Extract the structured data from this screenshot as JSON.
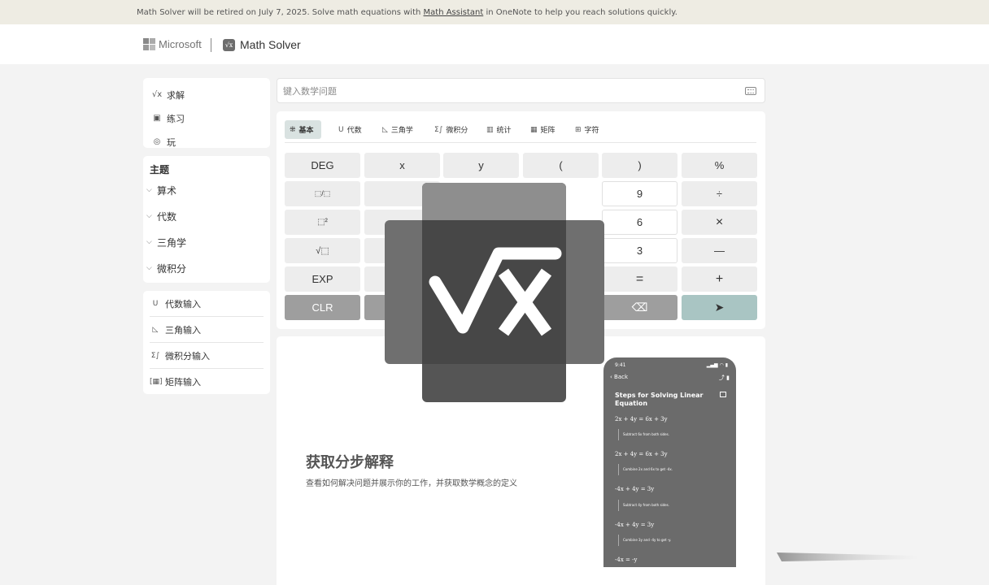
{
  "banner": {
    "text_before": "Math Solver will be retired on July 7, 2025. Solve math equations with ",
    "link": "Math Assistant",
    "text_after": " in OneNote to help you reach solutions quickly."
  },
  "header": {
    "brand": "Microsoft",
    "app_icon": "√x",
    "app_title": "Math Solver"
  },
  "nav": {
    "items": [
      {
        "icon": "√x",
        "label": "求解"
      },
      {
        "icon": "▣",
        "label": "练习"
      },
      {
        "icon": "◎",
        "label": "玩"
      }
    ]
  },
  "topics": {
    "title": "主题",
    "items": [
      {
        "label": "算术"
      },
      {
        "label": "代数"
      },
      {
        "label": "三角学"
      },
      {
        "label": "微积分"
      }
    ]
  },
  "inputs": {
    "items": [
      {
        "icon": "U",
        "label": "代数输入"
      },
      {
        "icon": "◺",
        "label": "三角输入"
      },
      {
        "icon": "Σ∫",
        "label": "微积分输入"
      },
      {
        "icon": "[▦]",
        "label": "矩阵输入"
      }
    ]
  },
  "search": {
    "placeholder": "键入数学问题"
  },
  "calculator": {
    "tabs": [
      {
        "icon": "⁜",
        "label": "基本"
      },
      {
        "icon": "U",
        "label": "代数"
      },
      {
        "icon": "◺",
        "label": "三角学"
      },
      {
        "icon": "Σ∫",
        "label": "微积分"
      },
      {
        "icon": "▥",
        "label": "统计"
      },
      {
        "icon": "▦",
        "label": "矩阵"
      },
      {
        "icon": "⊞",
        "label": "字符"
      }
    ],
    "keys": {
      "deg": "DEG",
      "x": "x",
      "y": "y",
      "lparen": "(",
      "rparen": ")",
      "percent": "%",
      "fraction": "⬚/⬚",
      "nine": "9",
      "divide": "÷",
      "power": "⬚²",
      "six": "6",
      "multiply": "×",
      "sqrt": "√⬚",
      "three": "3",
      "minus": "—",
      "exp": "EXP",
      "equals": "=",
      "plus": "+",
      "clr": "CLR",
      "backspace": "⌫",
      "send": "➤"
    }
  },
  "promo": {
    "title": "获取分步解释",
    "subtitle": "查看如何解决问题并展示你的工作，并获取数学概念的定义"
  },
  "phone": {
    "time": "9:41",
    "status_icons": "▂▄▆ ◠ ▮",
    "back": "‹  Back",
    "actions": "⤴  ▮",
    "steps_title": "Steps for Solving Linear Equation",
    "steps": [
      {
        "eq": "2x + 4y = 6x + 3y",
        "note": "Subtract 6x from both sides."
      },
      {
        "eq": "2x + 4y = 6x + 3y",
        "note": "Combine 2x and 6x to get -4x."
      },
      {
        "eq": "-4x + 4y = 3y",
        "note": "Subtract 4y from both sides."
      },
      {
        "eq": "-4x + 4y = 3y",
        "note": "Combine 3y and -4y to get -y."
      },
      {
        "eq": "-4x = -y",
        "note": ""
      }
    ]
  },
  "overlay_logo": "√x",
  "colors": {
    "banner_bg": "#eeece3",
    "page_bg": "#f3f3f3",
    "active_tab": "#d9e2e1",
    "send_key": "#a9c5c3",
    "clr_key": "#9e9e9e"
  }
}
